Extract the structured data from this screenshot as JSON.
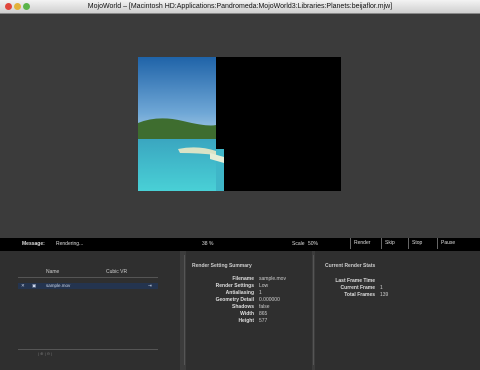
{
  "window": {
    "title": "MojoWorld – [Macintosh HD:Applications:Pandromeda:MojoWorld3:Libraries:Planets:beijaflor.mjw]"
  },
  "status": {
    "message_label": "Message:",
    "message_value": "Rendering...",
    "progress": "38 %",
    "scale_label": "Scale",
    "scale_value": "50%"
  },
  "buttons": {
    "render": "Render",
    "skip": "Skip",
    "stop": "Stop",
    "pause": "Pause"
  },
  "left_panel": {
    "columns": [
      "Name",
      "Cubic VR"
    ],
    "rows": [
      {
        "name": "sample.mov"
      }
    ]
  },
  "summary": {
    "title": "Render Setting Summary",
    "items": [
      {
        "key": "Filename",
        "value": "sample.mov"
      },
      {
        "key": "Render Settings",
        "value": "Low"
      },
      {
        "key": "Antialiasing",
        "value": "1"
      },
      {
        "key": "Geometry Detail",
        "value": "0.000000"
      },
      {
        "key": "Shadows",
        "value": "false"
      },
      {
        "key": "Width",
        "value": "865"
      },
      {
        "key": "Height",
        "value": "577"
      }
    ]
  },
  "stats": {
    "title": "Current Render Stats",
    "items": [
      {
        "key": "Last Frame Time",
        "value": ""
      },
      {
        "key": "Current Frame",
        "value": "1"
      },
      {
        "key": "Total Frames",
        "value": "139"
      }
    ]
  }
}
